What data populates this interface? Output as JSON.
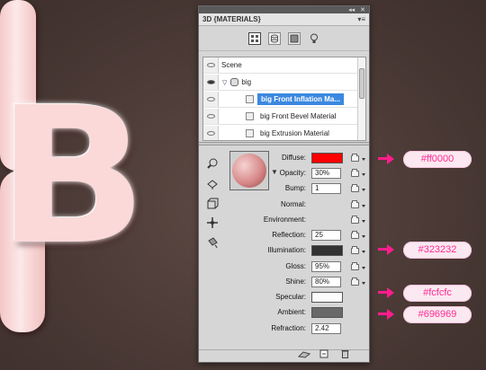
{
  "background": {
    "letter_b": "B"
  },
  "panel": {
    "collapse_glyph": "◂◂",
    "close_glyph": "✕",
    "tab_title": "3D {MATERIALS}",
    "menu_glyph": "▾≡",
    "tree": {
      "rows": [
        {
          "label": "Scene"
        },
        {
          "label": "big"
        },
        {
          "label": "big Front Inflation Ma..."
        },
        {
          "label": "big Front Bevel Material"
        },
        {
          "label": "big Extrusion Material"
        }
      ]
    },
    "properties": {
      "diffuse": {
        "label": "Diffuse:",
        "color": "#ff0000"
      },
      "opacity": {
        "label": "Opacity:",
        "value": "30%"
      },
      "bump": {
        "label": "Bump:",
        "value": "1"
      },
      "normal": {
        "label": "Normal:"
      },
      "environment": {
        "label": "Environment:"
      },
      "reflection": {
        "label": "Reflection:",
        "value": "25"
      },
      "illumination": {
        "label": "Illumination:",
        "color": "#323232"
      },
      "gloss": {
        "label": "Gloss:",
        "value": "95%"
      },
      "shine": {
        "label": "Shine:",
        "value": "80%"
      },
      "specular": {
        "label": "Specular:",
        "color": "#fcfcfc"
      },
      "ambient": {
        "label": "Ambient:",
        "color": "#696969"
      },
      "refraction": {
        "label": "Refraction:",
        "value": "2.42"
      }
    }
  },
  "callouts": [
    {
      "text": "#ff0000"
    },
    {
      "text": "#323232"
    },
    {
      "text": "#fcfcfc"
    },
    {
      "text": "#696969"
    }
  ],
  "colors": {
    "callout_accent": "#ff1d8d",
    "selection": "#3b88e0"
  }
}
